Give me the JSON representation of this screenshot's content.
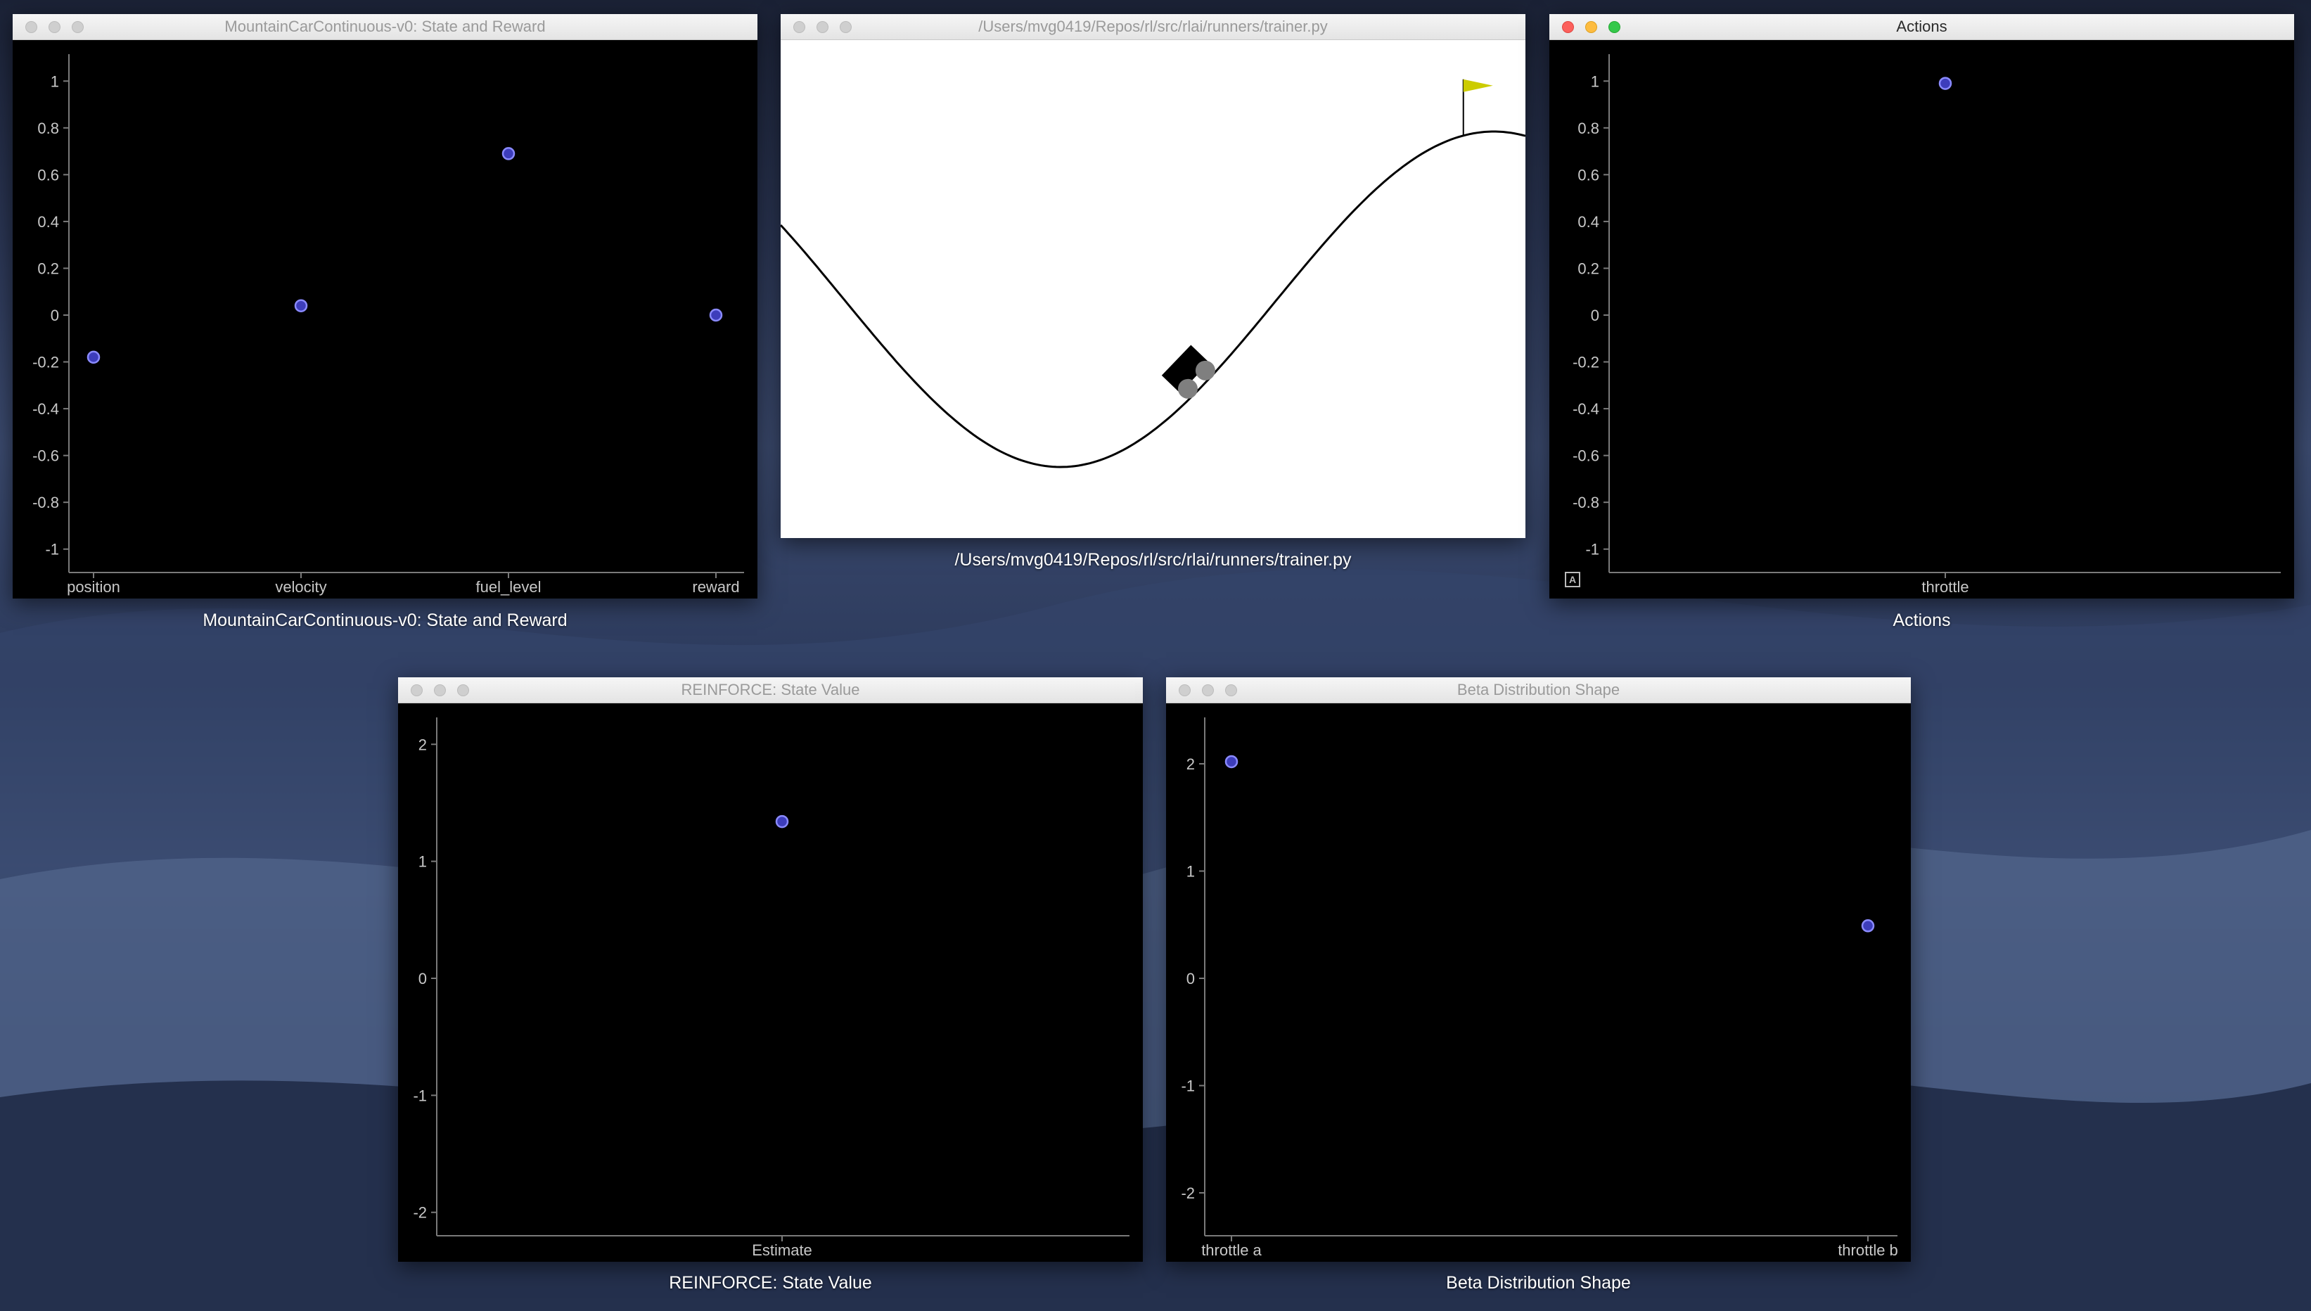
{
  "windows": {
    "state_reward": {
      "title": "MountainCarContinuous-v0:  State and Reward",
      "caption": "MountainCarContinuous-v0:  State and Reward"
    },
    "render": {
      "title": "/Users/mvg0419/Repos/rl/src/rlai/runners/trainer.py",
      "caption": "/Users/mvg0419/Repos/rl/src/rlai/runners/trainer.py"
    },
    "actions": {
      "title": "Actions",
      "caption": "Actions",
      "badge": "A"
    },
    "state_value": {
      "title": "REINFORCE:  State Value",
      "caption": "REINFORCE:  State Value"
    },
    "beta_shape": {
      "title": "Beta Distribution Shape",
      "caption": "Beta Distribution Shape"
    }
  },
  "colors": {
    "plot_background": "#000000",
    "point_fill": "#3d3dbb",
    "point_stroke": "#8a8aff",
    "axis": "#7a7a7a",
    "tick_label": "#c8c8c8",
    "flag": "#cccc00",
    "track": "#000000",
    "car_body": "#000000",
    "wheel": "#7f7f7f"
  },
  "chart_data": [
    {
      "id": "state_reward",
      "type": "scatter",
      "categories": [
        "position",
        "velocity",
        "fuel_level",
        "reward"
      ],
      "values": [
        -0.18,
        0.04,
        0.69,
        0.0
      ],
      "ylim": [
        -1.1,
        1.1
      ],
      "yticks": [
        1,
        0.8,
        0.6,
        0.4,
        0.2,
        0,
        -0.2,
        -0.4,
        -0.6,
        -0.8,
        -1
      ],
      "ytick_labels": [
        "1",
        "0.8",
        "0.6",
        "0.4",
        "0.2",
        "0",
        "-0.2",
        "-0.4",
        "-0.6",
        "-0.8",
        "-1"
      ]
    },
    {
      "id": "actions",
      "type": "scatter",
      "categories": [
        "throttle"
      ],
      "values": [
        0.99
      ],
      "ylim": [
        -1.1,
        1.1
      ],
      "yticks": [
        1,
        0.8,
        0.6,
        0.4,
        0.2,
        0,
        -0.2,
        -0.4,
        -0.6,
        -0.8,
        -1
      ],
      "ytick_labels": [
        "1",
        "0.8",
        "0.6",
        "0.4",
        "0.2",
        "0",
        "-0.2",
        "-0.4",
        "-0.6",
        "-0.8",
        "-1"
      ]
    },
    {
      "id": "state_value",
      "type": "scatter",
      "categories": [
        "Estimate"
      ],
      "values": [
        1.34
      ],
      "ylim": [
        -2.2,
        2.2
      ],
      "yticks": [
        2,
        1,
        0,
        -1,
        -2
      ],
      "ytick_labels": [
        "2",
        "1",
        "0",
        "-1",
        "-2"
      ]
    },
    {
      "id": "beta_shape",
      "type": "scatter",
      "categories": [
        "throttle a",
        "throttle b"
      ],
      "values": [
        2.02,
        0.49
      ],
      "ylim": [
        -2.4,
        2.4
      ],
      "yticks": [
        2,
        1,
        0,
        -1,
        -2
      ],
      "ytick_labels": [
        "2",
        "1",
        "0",
        "-1",
        "-2"
      ]
    }
  ],
  "scene": {
    "type": "mountain-car",
    "position": -0.18,
    "velocity": 0.04,
    "x_range": [
      -1.2,
      0.6
    ],
    "goal_position": 0.45
  }
}
